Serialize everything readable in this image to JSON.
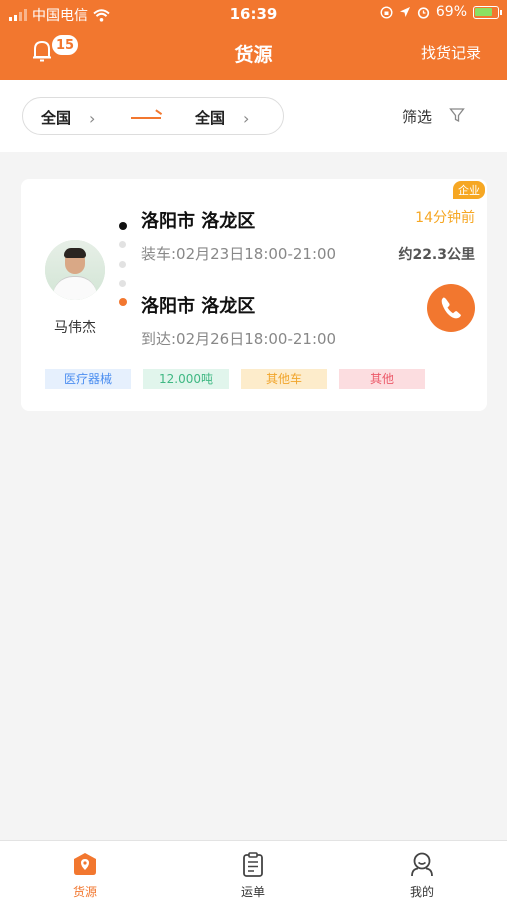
{
  "status_bar": {
    "carrier": "中国电信",
    "time": "16:39",
    "battery": "69%"
  },
  "nav": {
    "notification_count": "15",
    "title": "货源",
    "right_action": "找货记录"
  },
  "filter": {
    "from": "全国",
    "to": "全国",
    "filter_label": "筛选"
  },
  "listing": {
    "enterprise_tag": "企业",
    "driver_name": "马伟杰",
    "origin": "洛阳市  洛龙区",
    "load_time": "装车:02月23日18:00-21:00",
    "destination": "洛阳市  洛龙区",
    "arrive_time": "到达:02月26日18:00-21:00",
    "posted_ago": "14分钟前",
    "distance": "约22.3公里",
    "tags": [
      "医疗器械",
      "12.000吨",
      "其他车",
      "其他"
    ]
  },
  "tabs": [
    {
      "label": "货源",
      "icon": "cargo-pin-icon",
      "active": true
    },
    {
      "label": "运单",
      "icon": "clipboard-icon",
      "active": false
    },
    {
      "label": "我的",
      "icon": "user-icon",
      "active": false
    }
  ],
  "colors": {
    "brand": "#f2772f",
    "accent_yellow": "#f6a723",
    "tag_blue_bg": "#e6f0fd",
    "tag_blue_text": "#4c8ef0",
    "tag_green_bg": "#e1f5ec",
    "tag_green_text": "#3fb883",
    "tag_yellow_bg": "#fdeccb",
    "tag_yellow_text": "#f1a52c",
    "tag_red_bg": "#fcdde0",
    "tag_red_text": "#ec5a6a"
  }
}
